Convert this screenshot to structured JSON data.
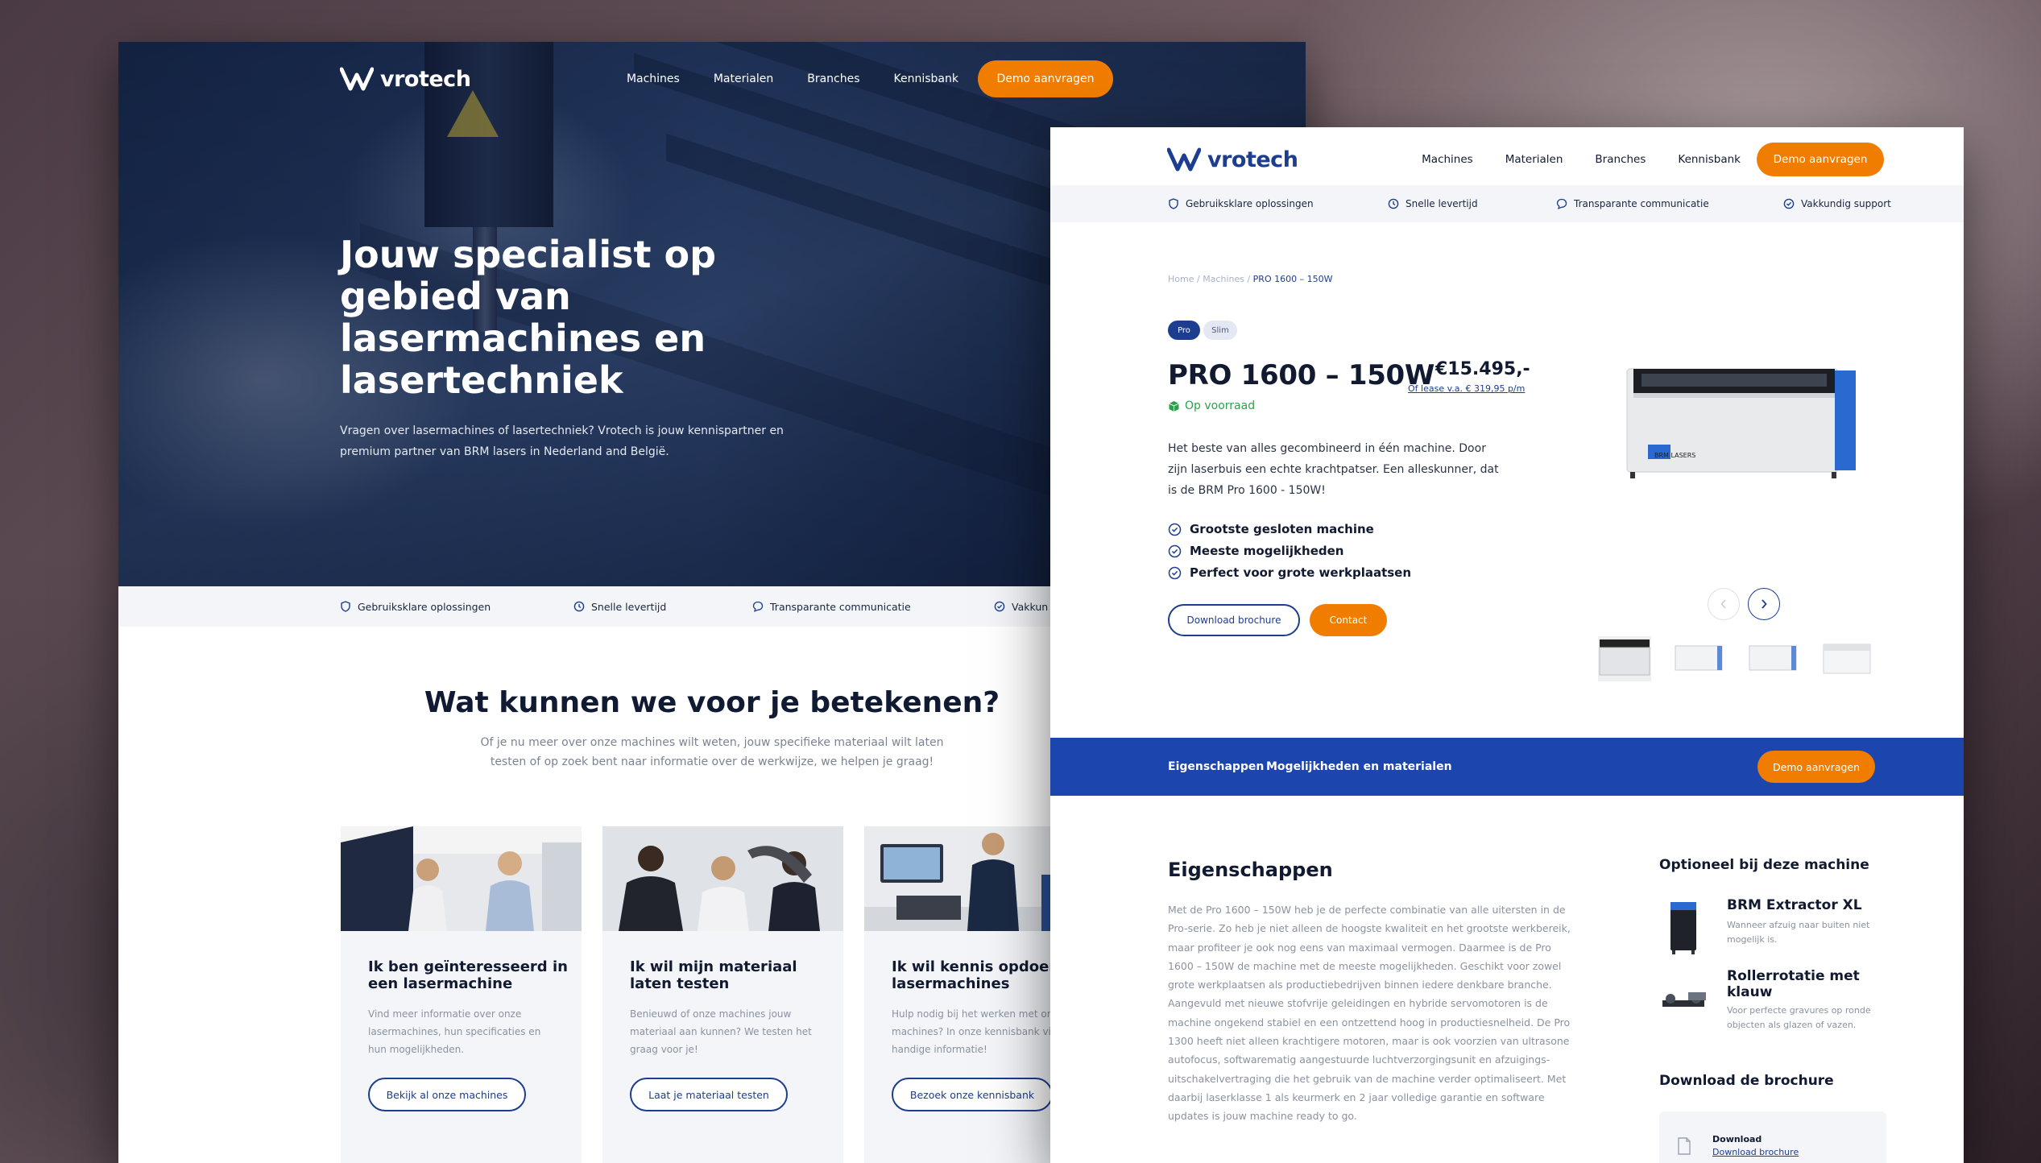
{
  "colors": {
    "brand_blue": "#1d3d8f",
    "accent_orange": "#f07d00",
    "band_blue": "#1c45ad",
    "stock_green": "#2fa04a"
  },
  "left": {
    "logo": "vrotech",
    "nav": [
      "Machines",
      "Materialen",
      "Branches",
      "Kennisbank"
    ],
    "cta": "Demo aanvragen",
    "hero_title": "Jouw specialist op gebied van lasermachines en lasertechniek",
    "hero_sub": "Vragen over lasermachines of lasertechniek? Vrotech is jouw kennispartner en premium partner van BRM lasers in Nederland and België.",
    "usps": [
      "Gebruiksklare oplossingen",
      "Snelle levertijd",
      "Transparante communicatie",
      "Vakkun"
    ],
    "section_title": "Wat kunnen we voor je betekenen?",
    "section_sub": "Of je nu meer over onze machines wilt weten, jouw specifieke materiaal wilt laten testen of op zoek bent naar informatie over de werkwijze, we helpen je graag!",
    "cards": [
      {
        "title": "Ik ben geïnteresseerd in een lasermachine",
        "text": "Vind meer informatie over onze lasermachines, hun specificaties en hun mogelijkheden.",
        "button": "Bekijk al onze machines"
      },
      {
        "title": "Ik wil mijn materiaal laten testen",
        "text": "Benieuwd of onze machines jouw materiaal aan kunnen? We testen het graag voor je!",
        "button": "Laat je materiaal testen"
      },
      {
        "title": "Ik wil kennis opdoen o lasermachines",
        "text": "Hulp nodig bij het werken met onz machines? In onze kennisbank vin handige informatie!",
        "button": "Bezoek onze kennisbank"
      }
    ]
  },
  "right": {
    "logo": "vrotech",
    "nav": [
      "Machines",
      "Materialen",
      "Branches",
      "Kennisbank"
    ],
    "cta": "Demo aanvragen",
    "usps": [
      "Gebruiksklare oplossingen",
      "Snelle levertijd",
      "Transparante communicatie",
      "Vakkundig support"
    ],
    "breadcrumb": {
      "home": "Home",
      "sep": " / ",
      "machines": "Machines",
      "current": "PRO 1600 – 150W"
    },
    "tags": [
      "Pro",
      "Slim"
    ],
    "title": "PRO 1600 – 150W",
    "price": "€15.495,-",
    "lease": "Of lease v.a. € 319,95 p/m",
    "stock": "Op voorraad",
    "description": "Het beste van alles gecombineerd in één machine. Door zijn laserbuis een echte krachtpatser. Een alleskunner, dat is de BRM Pro 1600 - 150W!",
    "features": [
      "Grootste gesloten machine",
      "Meeste mogelijkheden",
      "Perfect voor grote werkplaatsen"
    ],
    "btn_brochure": "Download brochure",
    "btn_contact": "Contact",
    "machine_brand": "BRM LASERS",
    "tabs": [
      "Eigenschappen",
      "Mogelijkheden en materialen"
    ],
    "tab_cta": "Demo aanvragen",
    "eig_title": "Eigenschappen",
    "eig_text": "Met de Pro 1600 – 150W heb je de perfecte combinatie van alle uitersten in de Pro-serie. Zo heb je niet alleen de hoogste kwaliteit en het grootste werkbereik, maar profiteer je ook nog eens van maximaal vermogen. Daarmee is de Pro 1600 – 150W de machine met de meeste mogelijkheden. Geschikt voor zowel grote werkplaatsen als productiebedrijven binnen iedere denkbare branche. Aangevuld met nieuwe stofvrije geleidingen en hybride servomotoren is de machine ongekend stabiel en een ontzettend hoog in productiesnelheid. De Pro 1300 heeft niet alleen krachtigere motoren, maar is ook voorzien van ultrasone autofocus, softwarematig aangestuurde luchtverzorgingsunit en afzuigings-uitschakelvertraging die het gebruik van de machine verder optimaliseert. Met daarbij laserklasse 1 als keurmerk en 2 jaar volledige garantie en software updates is jouw machine ready to go.",
    "opt_title": "Optioneel bij deze machine",
    "options": [
      {
        "name": "BRM Extractor XL",
        "desc": "Wanneer afzuig naar buiten niet mogelijk is."
      },
      {
        "name": "Rollerrotatie met klauw",
        "desc": "Voor perfecte gravures op ronde objecten als glazen of vazen."
      }
    ],
    "dl_title": "Download de brochure",
    "dl_label": "Download",
    "dl_link": "Download brochure"
  }
}
